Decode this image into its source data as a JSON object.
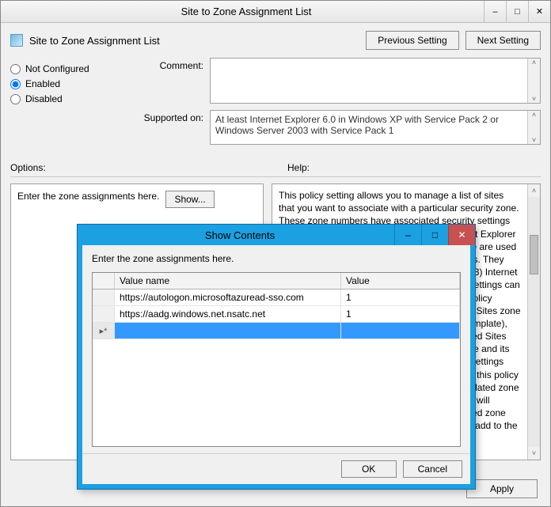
{
  "window": {
    "title": "Site to Zone Assignment List",
    "header_title": "Site to Zone Assignment List",
    "prev_btn": "Previous Setting",
    "next_btn": "Next Setting",
    "apply_btn": "Apply"
  },
  "radios": {
    "not_configured": "Not Configured",
    "enabled": "Enabled",
    "disabled": "Disabled",
    "selected": "enabled"
  },
  "comment": {
    "label": "Comment:",
    "value": ""
  },
  "supported": {
    "label": "Supported on:",
    "value": "At least Internet Explorer 6.0 in Windows XP with Service Pack 2 or Windows Server 2003 with Service Pack 1"
  },
  "section_labels": {
    "options": "Options:",
    "help": "Help:"
  },
  "options_panel": {
    "prompt": "Enter the zone assignments here.",
    "show_btn": "Show..."
  },
  "help_text": "This policy setting allows you to manage a list of sites that you want to associate with a particular security zone. These zone numbers have associated security settings that apply to all of the sites in the zone.\n\nInternet Explorer has 4 security zones, numbered 1-4, and these are used by this policy setting to associate sites to zones. They are: (1) Intranet zone, (2) Trusted Sites zone, (3) Internet zone, and (4) Restricted Sites zone. Security settings can be set for each of these zones through other policy settings, and their default settings are: Trusted Sites zone (Low template), Intranet zone (Medium-Low template), Internet zone (Medium template), and Restricted Sites zone (High template). (The Local Machine zone and its locked down equivalent have special security settings that protect your local computer.)\n\nIf you enable this policy setting, you can enter a list of sites and their related zone numbers. The association of a site with a zone will ensure that the security settings for the specified zone are applied to the site. For each entry that you add to the list, enter",
  "modal": {
    "title": "Show Contents",
    "prompt": "Enter the zone assignments here.",
    "columns": {
      "name": "Value name",
      "value": "Value"
    },
    "rows": [
      {
        "name": "https://autologon.microsoftazuread-sso.com",
        "value": "1"
      },
      {
        "name": "https://aadg.windows.net.nsatc.net",
        "value": "1"
      }
    ],
    "new_row_marker": "▸*",
    "ok": "OK",
    "cancel": "Cancel"
  }
}
